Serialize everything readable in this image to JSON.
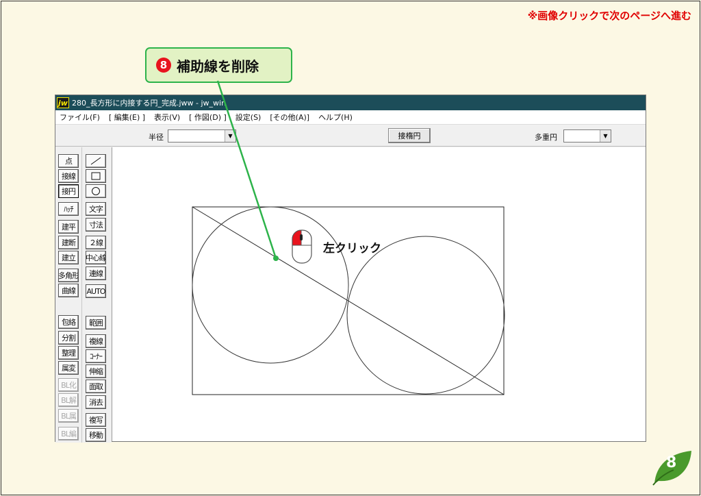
{
  "slide": {
    "next_hint": "※画像クリックで次のページへ進む",
    "step_number": "8",
    "step_title": "補助線を削除",
    "click_label": "左クリック",
    "page_number": "8",
    "colors": {
      "background": "#fcf8e4",
      "callout_border": "#2db34a",
      "callout_fill": "#e2f2c4",
      "accent_red": "#e8141e",
      "leaf": "#4a9a2c"
    }
  },
  "window": {
    "icon": "jw",
    "title": "280_長方形に内接する円_完成.jww - jw_win",
    "menu": [
      "ファイル(F)",
      "[ 編集(E) ]",
      "表示(V)",
      "[ 作図(D) ]",
      "設定(S)",
      "[その他(A)]",
      "ヘルプ(H)"
    ],
    "toolbar": {
      "radius_label": "半径",
      "radius_value": "",
      "tangent_circle_button": "接楕円",
      "multi_circle_label": "多重円",
      "multi_circle_value": ""
    },
    "tools_left": [
      "点",
      "接線",
      "接円",
      "ﾊｯﾁ",
      "建平",
      "建断",
      "建立",
      "多角形",
      "曲線",
      "包絡",
      "分割",
      "整理",
      "属変",
      "BL化",
      "BL解",
      "BL属",
      "BL編"
    ],
    "tools_right": [
      "文字",
      "寸法",
      "２線",
      "中心線",
      "連線",
      "AUTO",
      "範囲",
      "複線",
      "ｺｰﾅｰ",
      "伸縮",
      "面取",
      "消去",
      "複写",
      "移動"
    ],
    "active_tool": "接円",
    "disabled_tools": [
      "BL化",
      "BL解",
      "BL属",
      "BL編"
    ]
  }
}
